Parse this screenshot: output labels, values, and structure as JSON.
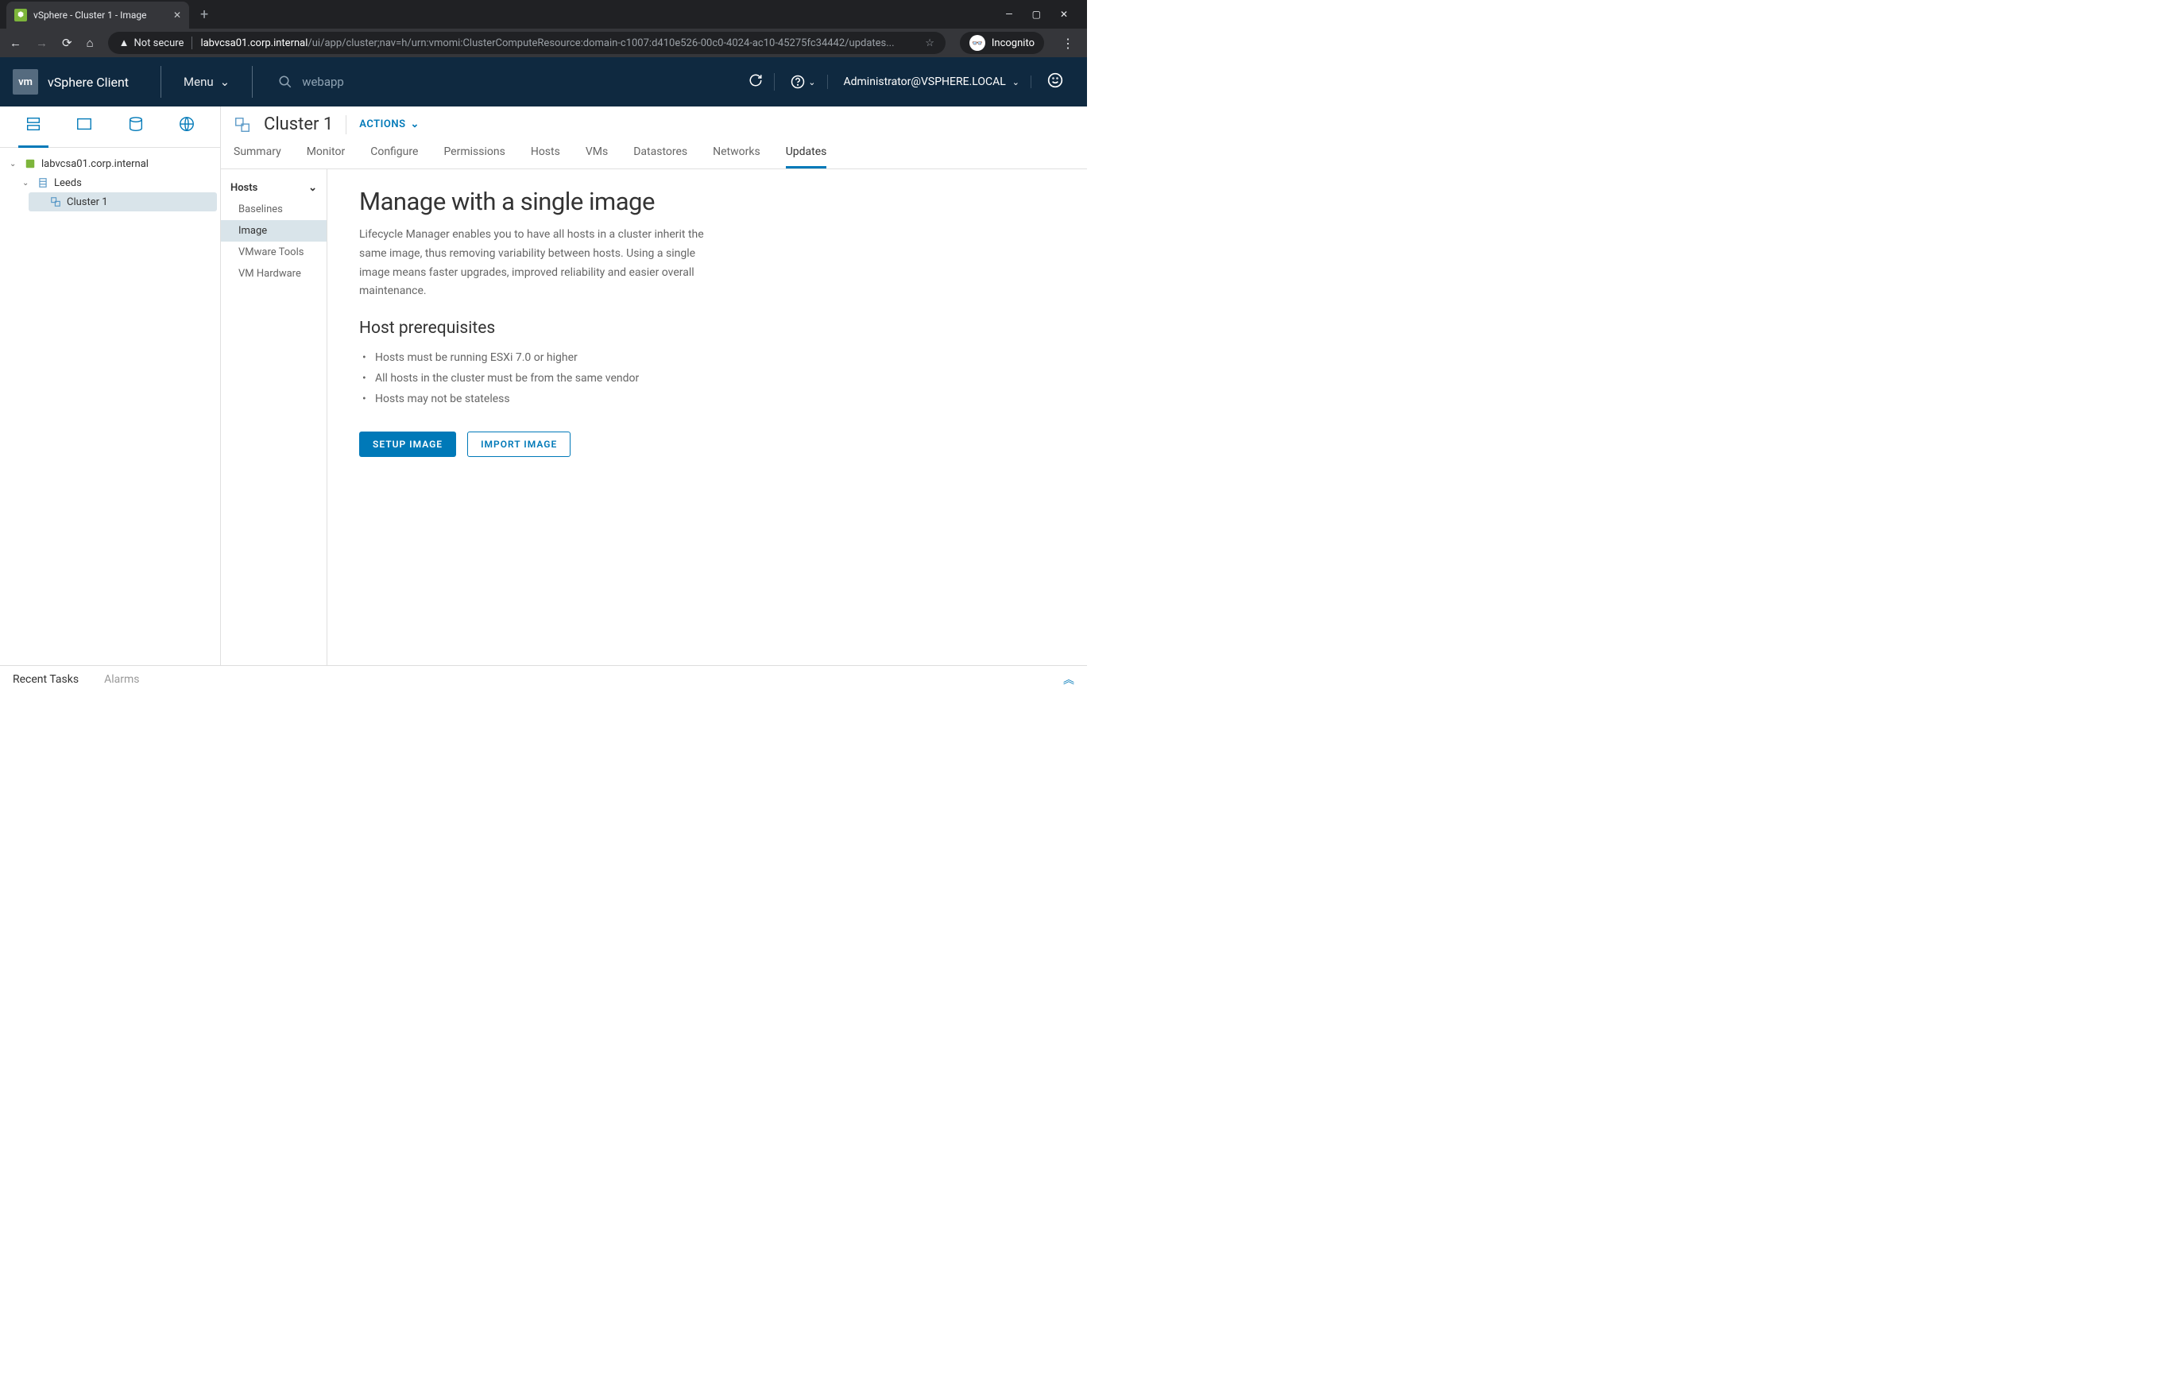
{
  "browser": {
    "tab_title": "vSphere - Cluster 1 - Image",
    "not_secure": "Not secure",
    "url_host": "labvcsa01.corp.internal",
    "url_path": "/ui/app/cluster;nav=h/urn:vmomi:ClusterComputeResource:domain-c1007:d410e526-00c0-4024-ac10-45275fc34442/updates...",
    "incognito": "Incognito"
  },
  "header": {
    "logo": "vm",
    "client": "vSphere Client",
    "menu": "Menu",
    "search": "webapp",
    "user": "Administrator@VSPHERE.LOCAL"
  },
  "tree": {
    "root": "labvcsa01.corp.internal",
    "datacenter": "Leeds",
    "cluster": "Cluster 1"
  },
  "content": {
    "title": "Cluster 1",
    "actions": "ACTIONS",
    "tabs": [
      "Summary",
      "Monitor",
      "Configure",
      "Permissions",
      "Hosts",
      "VMs",
      "Datastores",
      "Networks",
      "Updates"
    ],
    "active_tab": "Updates"
  },
  "side": {
    "section": "Hosts",
    "items": [
      "Baselines",
      "Image",
      "VMware Tools",
      "VM Hardware"
    ],
    "active": "Image"
  },
  "main": {
    "heading": "Manage with a single image",
    "desc": "Lifecycle Manager enables you to have all hosts in a cluster inherit the same image, thus removing variability between hosts. Using a single image means faster upgrades, improved reliability and easier overall maintenance.",
    "prereq_heading": "Host prerequisites",
    "prereqs": [
      "Hosts must be running ESXi 7.0 or higher",
      "All hosts in the cluster must be from the same vendor",
      "Hosts may not be stateless"
    ],
    "setup_btn": "SETUP IMAGE",
    "import_btn": "IMPORT IMAGE"
  },
  "bottom": {
    "recent": "Recent Tasks",
    "alarms": "Alarms"
  }
}
